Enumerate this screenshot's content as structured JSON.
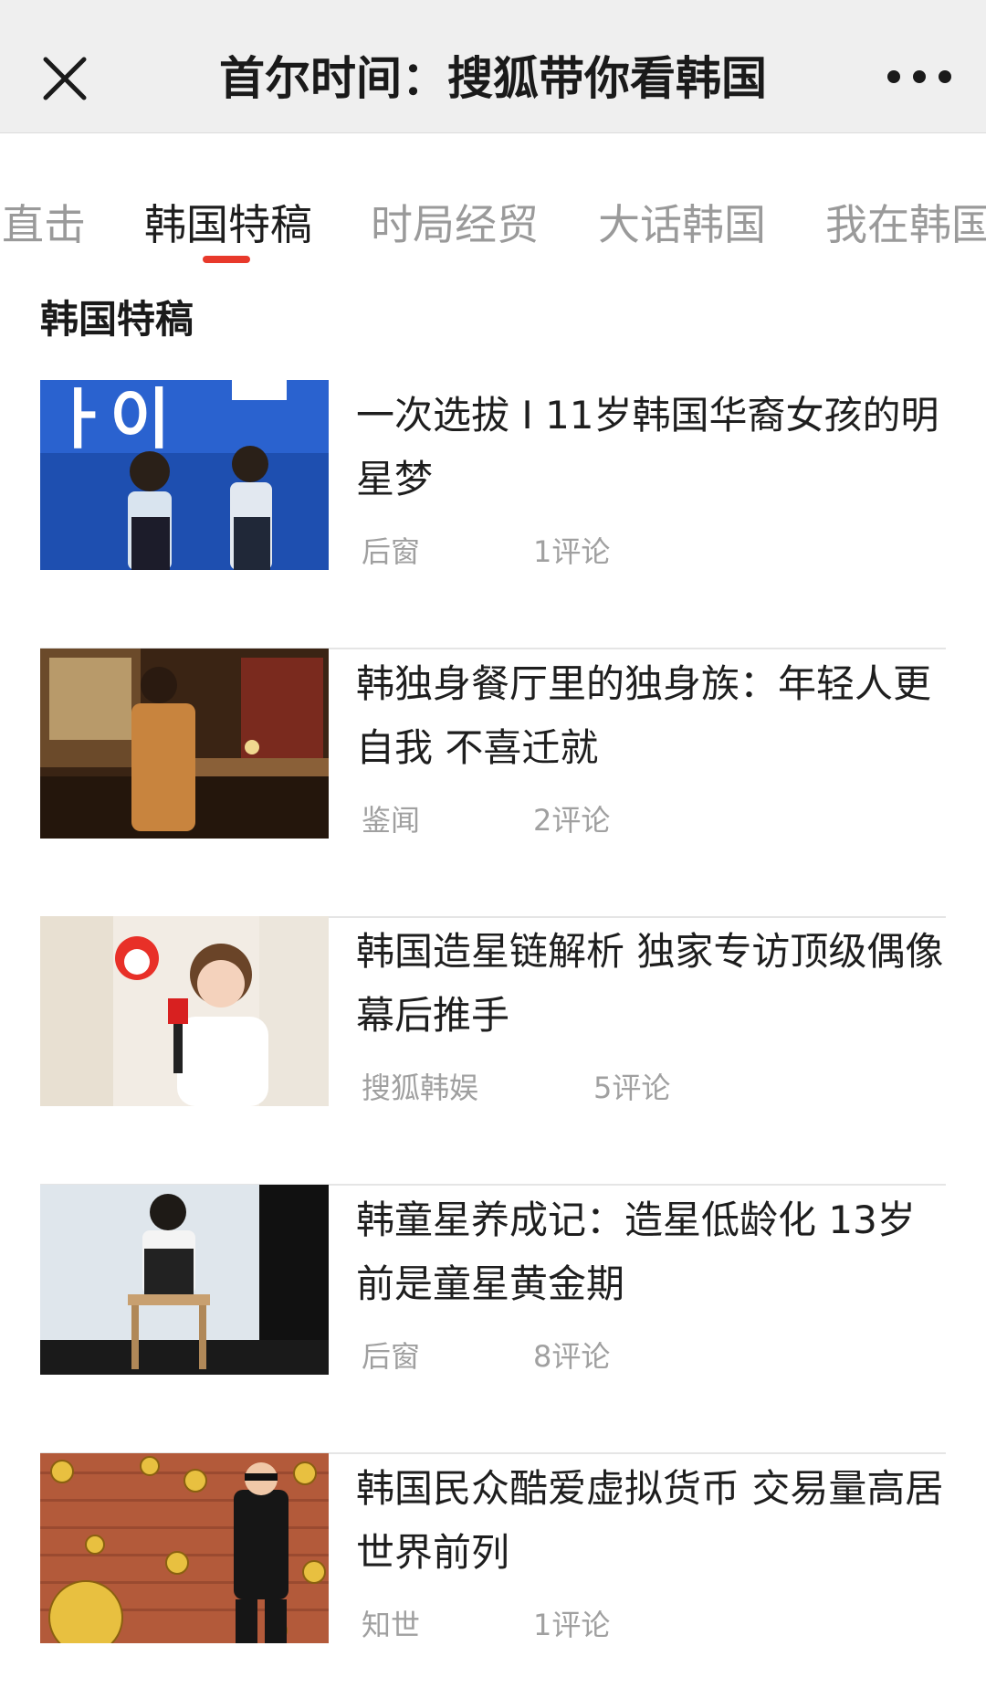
{
  "header": {
    "title": "首尔时间：搜狐带你看韩国",
    "close_icon": "close-icon",
    "more_icon": "more-dots-icon"
  },
  "tabs": [
    {
      "label": "直击",
      "active": false
    },
    {
      "label": "韩国特稿",
      "active": true
    },
    {
      "label": "时局经贸",
      "active": false
    },
    {
      "label": "大话韩国",
      "active": false
    },
    {
      "label": "我在韩国",
      "active": false
    }
  ],
  "colors": {
    "accent": "#e8392b"
  },
  "section": {
    "title": "韩国特稿"
  },
  "articles": [
    {
      "headline": "一次选拔 I 11岁韩国华裔女孩的明星梦",
      "source": "后窗",
      "comments": "1评论"
    },
    {
      "headline": "韩独身餐厅里的独身族：年轻人更自我 不喜迁就",
      "source": "鉴闻",
      "comments": "2评论"
    },
    {
      "headline": "韩国造星链解析 独家专访顶级偶像幕后推手",
      "source": "搜狐韩娱",
      "comments": "5评论"
    },
    {
      "headline": "韩童星养成记：造星低龄化 13岁前是童星黄金期",
      "source": "后窗",
      "comments": "8评论"
    },
    {
      "headline": "韩国民众酷爱虚拟货币 交易量高居世界前列",
      "source": "知世",
      "comments": "1评论"
    }
  ]
}
